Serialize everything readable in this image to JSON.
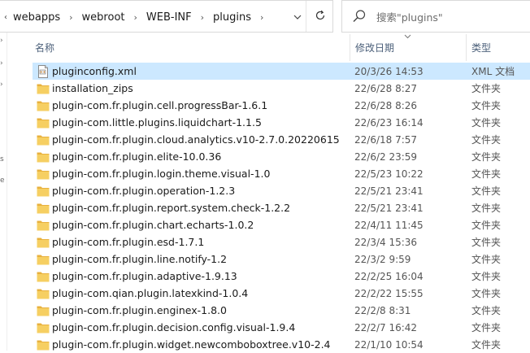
{
  "breadcrumbs": [
    "webapps",
    "webroot",
    "WEB-INF",
    "plugins"
  ],
  "search": {
    "placeholder": "搜索\"plugins\""
  },
  "columns": {
    "name": "名称",
    "date": "修改日期",
    "type": "类型"
  },
  "files": [
    {
      "name": "pluginconfig.xml",
      "date": "20/3/26 14:53",
      "type": "XML 文档",
      "icon": "xml-file-icon",
      "selected": true
    },
    {
      "name": "installation_zips",
      "date": "22/6/28 8:27",
      "type": "文件夹",
      "icon": "folder-icon"
    },
    {
      "name": "plugin-com.fr.plugin.cell.progressBar-1.6.1",
      "date": "22/6/28 8:26",
      "type": "文件夹",
      "icon": "folder-icon"
    },
    {
      "name": "plugin-com.little.plugins.liquidchart-1.1.5",
      "date": "22/6/23 16:14",
      "type": "文件夹",
      "icon": "folder-icon"
    },
    {
      "name": "plugin-com.fr.plugin.cloud.analytics.v10-2.7.0.20220615",
      "date": "22/6/18 7:57",
      "type": "文件夹",
      "icon": "folder-icon"
    },
    {
      "name": "plugin-com.fr.plugin.elite-10.0.36",
      "date": "22/6/2 23:59",
      "type": "文件夹",
      "icon": "folder-icon"
    },
    {
      "name": "plugin-com.fr.plugin.login.theme.visual-1.0",
      "date": "22/5/23 10:22",
      "type": "文件夹",
      "icon": "folder-icon"
    },
    {
      "name": "plugin-com.fr.plugin.operation-1.2.3",
      "date": "22/5/21 23:41",
      "type": "文件夹",
      "icon": "folder-icon"
    },
    {
      "name": "plugin-com.fr.plugin.report.system.check-1.2.2",
      "date": "22/5/21 23:41",
      "type": "文件夹",
      "icon": "folder-icon"
    },
    {
      "name": "plugin-com.fr.plugin.chart.echarts-1.0.2",
      "date": "22/4/11 11:45",
      "type": "文件夹",
      "icon": "folder-icon"
    },
    {
      "name": "plugin-com.fr.plugin.esd-1.7.1",
      "date": "22/3/4 15:36",
      "type": "文件夹",
      "icon": "folder-icon"
    },
    {
      "name": "plugin-com.fr.plugin.line.notify-1.2",
      "date": "22/3/2 9:59",
      "type": "文件夹",
      "icon": "folder-icon"
    },
    {
      "name": "plugin-com.fr.plugin.adaptive-1.9.13",
      "date": "22/2/25 16:04",
      "type": "文件夹",
      "icon": "folder-icon"
    },
    {
      "name": "plugin-com.qian.plugin.latexkind-1.0.4",
      "date": "22/2/22 15:55",
      "type": "文件夹",
      "icon": "folder-icon"
    },
    {
      "name": "plugin-com.fr.plugin.enginex-1.8.0",
      "date": "22/2/8 8:31",
      "type": "文件夹",
      "icon": "folder-icon"
    },
    {
      "name": "plugin-com.fr.plugin.decision.config.visual-1.9.4",
      "date": "22/2/7 16:42",
      "type": "文件夹",
      "icon": "folder-icon"
    },
    {
      "name": "plugin-com.fr.plugin.widget.newcomboboxtree.v10-2.4",
      "date": "22/1/10 10:54",
      "type": "文件夹",
      "icon": "folder-icon"
    }
  ],
  "colors": {
    "selected_row": "#cce8ff",
    "folder": "#f0c052",
    "header_text": "#4c607a"
  }
}
